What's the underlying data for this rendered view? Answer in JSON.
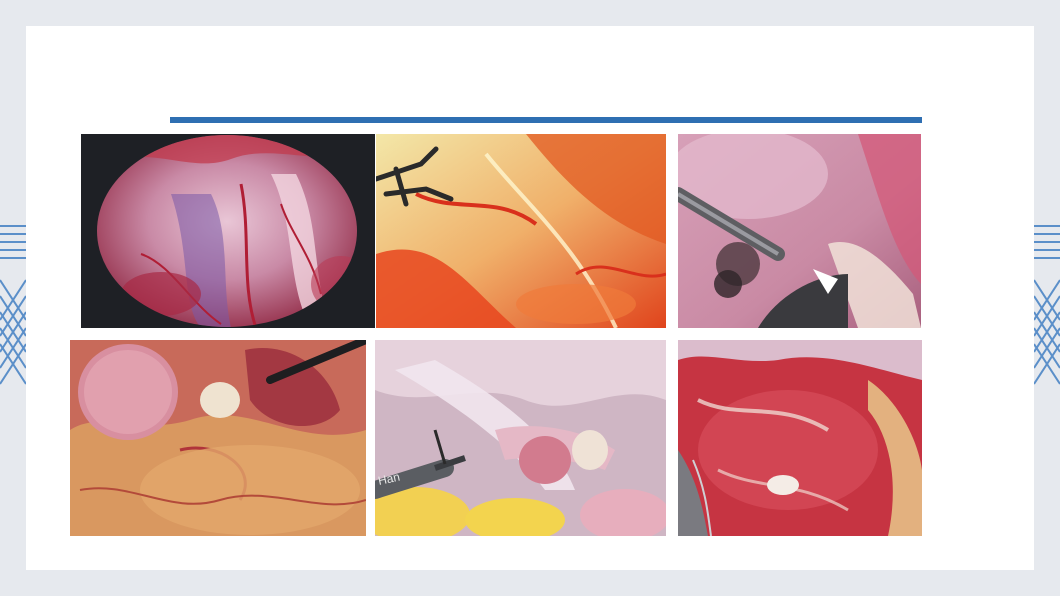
{
  "slide": {
    "accent_color": "#2f6fb2",
    "background_color": "#e6e9ee"
  },
  "photos": [
    {
      "name": "laparoscopic-view-circular"
    },
    {
      "name": "laparoscopic-view-grasper-bleeding"
    },
    {
      "name": "laparoscopic-view-cautery-dissection"
    },
    {
      "name": "laparoscopic-view-ovary-bowel"
    },
    {
      "name": "laparoscopic-view-tissue-grasper",
      "instrument_text": "Han"
    },
    {
      "name": "laparoscopic-view-raw-surface"
    }
  ]
}
